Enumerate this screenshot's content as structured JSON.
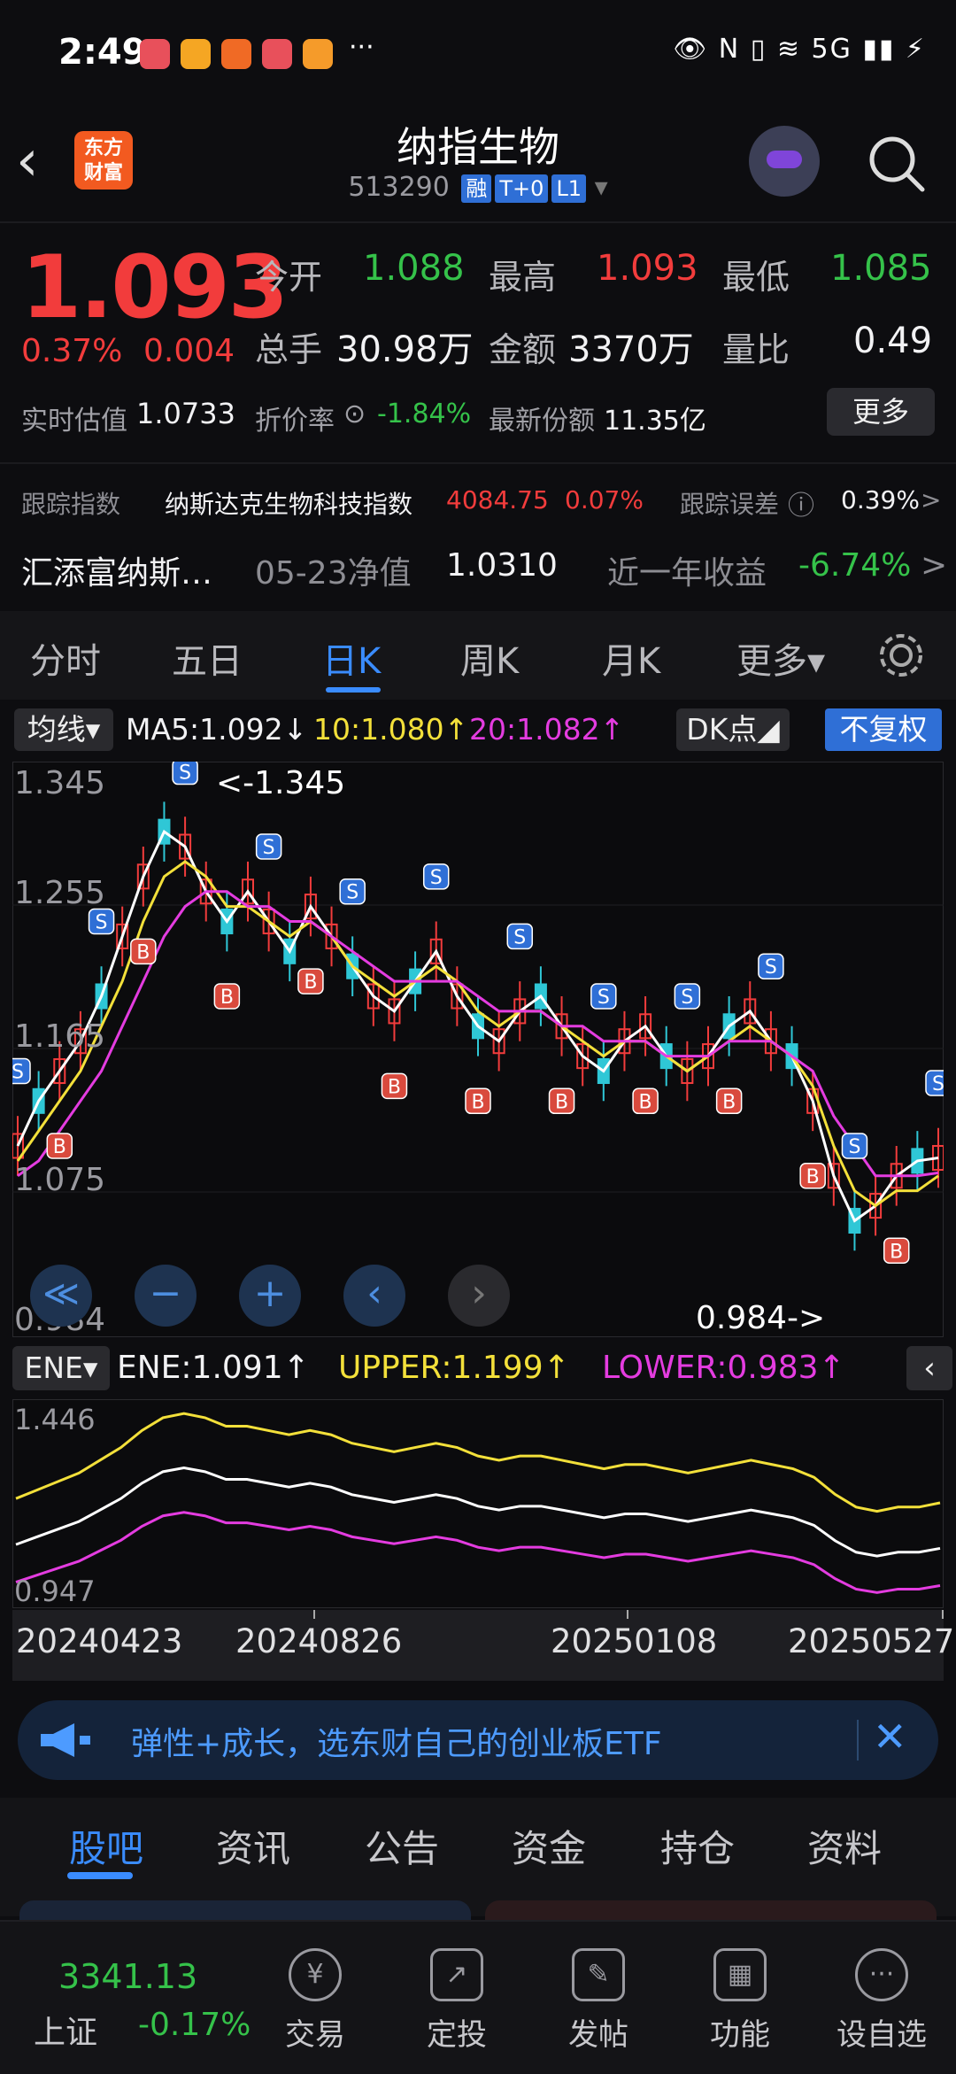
{
  "status": {
    "time": "2:49",
    "right_icons": "👁 N ▯ ≋ 5G ▮▮ ⚡",
    "more": "···",
    "notif_colors": [
      "#e8505b",
      "#f5a623",
      "#f06a25",
      "#e8505b",
      "#f59b2a"
    ]
  },
  "header": {
    "back": "‹",
    "logo": "东方\n财富",
    "name": "纳指生物",
    "code": "513290",
    "tags": [
      "融",
      "T+0",
      "L1"
    ],
    "dropdown": "▾"
  },
  "quote": {
    "price": "1.093",
    "pct": "0.37%",
    "chg": "0.004",
    "open_label": "今开",
    "open": "1.088",
    "high_label": "最高",
    "high": "1.093",
    "low_label": "最低",
    "low": "1.085",
    "vol_label": "总手",
    "vol": "30.98万",
    "amt_label": "金额",
    "amt": "3370万",
    "ratio_label": "量比",
    "ratio": "0.49",
    "iopv_label": "实时估值",
    "iopv": "1.0733",
    "discount_label": "折价率",
    "discount": "-1.84%",
    "shares_label": "最新份额",
    "shares": "11.35亿",
    "more": "更多"
  },
  "tracking": {
    "label": "跟踪指数",
    "index": "纳斯达克生物科技指数",
    "value": "4084.75",
    "pct": "0.07%",
    "err_label": "跟踪误差",
    "err": "0.39%",
    "arrow": ">"
  },
  "fund": {
    "name": "汇添富纳斯…",
    "nav_label": "05-23净值",
    "nav": "1.0310",
    "ret_label": "近一年收益",
    "ret": "-6.74%",
    "arrow": ">"
  },
  "ktabs": [
    "分时",
    "五日",
    "日K",
    "周K",
    "月K",
    "更多▾"
  ],
  "ma": {
    "selector": "均线▾",
    "ma5": "MA5:1.092↓",
    "ma10": "10:1.080↑",
    "ma20": "20:1.082↑",
    "dk": "DK点◢",
    "fq": "不复权"
  },
  "chart_labels": {
    "y_top": "1.345",
    "y_mid1": "1.255",
    "y_mid2": "1.165",
    "y_mid3": "1.075",
    "y_bottom": "0.984",
    "max_note": "<-1.345",
    "min_note": "0.984->"
  },
  "chart_controls": [
    "≪",
    "−",
    "+",
    "‹",
    "›"
  ],
  "ene": {
    "selector": "ENE▾",
    "ene": "ENE:1.091↑",
    "upper": "UPPER:1.199↑",
    "lower": "LOWER:0.983↑",
    "collapse": "‹",
    "y_top": "1.446",
    "y_bottom": "0.947"
  },
  "dates": [
    "20240423",
    "20240826",
    "20250108",
    "20250527"
  ],
  "ad": {
    "text": "弹性+成长，选东财自己的创业板ETF",
    "close": "✕"
  },
  "btabs": [
    "股吧",
    "资讯",
    "公告",
    "资金",
    "持仓",
    "资料"
  ],
  "bottom": {
    "index_val": "3341.13",
    "index_name": "上证",
    "index_pct": "-0.17%",
    "nav": [
      {
        "label": "交易",
        "icon": "¥"
      },
      {
        "label": "定投",
        "icon": "↗"
      },
      {
        "label": "发帖",
        "icon": "✎"
      },
      {
        "label": "功能",
        "icon": "▦"
      },
      {
        "label": "设自选",
        "icon": "···"
      }
    ]
  },
  "chart_data": {
    "type": "line",
    "title": "",
    "x_start": "20240423",
    "x_end": "20250527",
    "ylim": [
      0.984,
      1.345
    ],
    "series": [
      {
        "name": "MA5",
        "values": [
          1.1,
          1.13,
          1.15,
          1.17,
          1.2,
          1.24,
          1.28,
          1.31,
          1.3,
          1.27,
          1.25,
          1.27,
          1.25,
          1.23,
          1.26,
          1.24,
          1.22,
          1.2,
          1.19,
          1.21,
          1.23,
          1.2,
          1.18,
          1.17,
          1.19,
          1.2,
          1.18,
          1.16,
          1.15,
          1.17,
          1.18,
          1.16,
          1.15,
          1.16,
          1.18,
          1.19,
          1.17,
          1.16,
          1.13,
          1.08,
          1.05,
          1.06,
          1.08,
          1.09,
          1.092
        ]
      },
      {
        "name": "10",
        "values": [
          1.09,
          1.11,
          1.13,
          1.15,
          1.18,
          1.21,
          1.25,
          1.28,
          1.29,
          1.28,
          1.26,
          1.26,
          1.25,
          1.24,
          1.25,
          1.24,
          1.22,
          1.21,
          1.2,
          1.21,
          1.22,
          1.21,
          1.19,
          1.18,
          1.19,
          1.19,
          1.18,
          1.17,
          1.16,
          1.17,
          1.17,
          1.16,
          1.15,
          1.16,
          1.17,
          1.18,
          1.17,
          1.16,
          1.14,
          1.1,
          1.07,
          1.06,
          1.07,
          1.07,
          1.08
        ]
      },
      {
        "name": "20",
        "values": [
          1.08,
          1.09,
          1.11,
          1.13,
          1.15,
          1.18,
          1.21,
          1.24,
          1.26,
          1.27,
          1.27,
          1.26,
          1.26,
          1.25,
          1.25,
          1.24,
          1.23,
          1.22,
          1.21,
          1.21,
          1.21,
          1.21,
          1.2,
          1.19,
          1.19,
          1.19,
          1.18,
          1.18,
          1.17,
          1.17,
          1.17,
          1.16,
          1.16,
          1.16,
          1.17,
          1.17,
          1.17,
          1.16,
          1.15,
          1.12,
          1.1,
          1.08,
          1.08,
          1.08,
          1.082
        ]
      }
    ]
  }
}
